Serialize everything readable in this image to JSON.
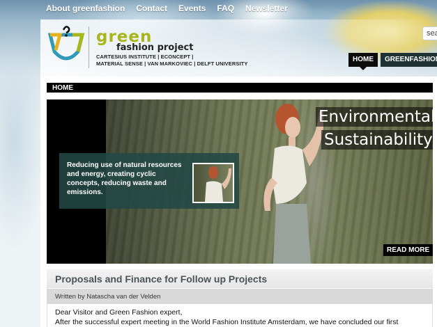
{
  "top_nav": [
    "About greenfashion",
    "Contact",
    "Events",
    "FAQ",
    "Newsletter"
  ],
  "search": {
    "value": "sea"
  },
  "logo": {
    "green": "green",
    "fashion_project": "fashion project",
    "partners_line1": "CARTESIUS INSTITUTE | ECONCEPT |",
    "partners_line2": "MATERIAL SENSE | VAN MARKOVIEC | DELFT UNIVERSITY"
  },
  "main_nav": [
    {
      "label": "HOME",
      "active": true
    },
    {
      "label": "GREENFASHION TO",
      "active": false
    }
  ],
  "breadcrumb": "HOME",
  "hero": {
    "title_line1": "Environmental",
    "title_line2": "Sustainability",
    "caption": "Reducing use of natural resources and energy, creating cyclic concepts, reducing waste and emissions.",
    "read_more": "READ MORE"
  },
  "article": {
    "title": "Proposals and Finance for Follow up Projects",
    "meta": "Written by Natascha van der Velden",
    "body_line1": "Dear Visitor and Green Fashion expert,",
    "body_line2": "After the successful expert meeting in the World Fashion Institute Amsterdam, we have concluded our first"
  },
  "colors": {
    "logo_green": "#a8b61c",
    "nav_dark": "#1e3234",
    "caption_bg": "#234844"
  }
}
